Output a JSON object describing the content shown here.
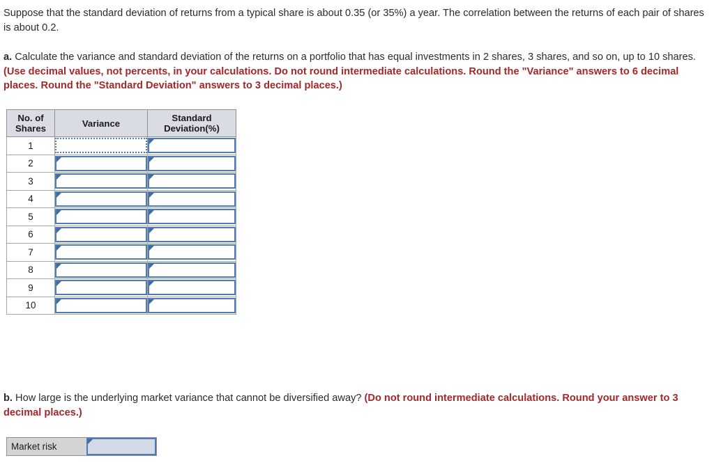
{
  "problem": {
    "intro": "Suppose that the standard deviation of returns from a typical share is about 0.35 (or 35%) a year. The correlation between the returns of each pair of shares is about 0.2.",
    "part_a": {
      "marker": "a.",
      "text": " Calculate the variance and standard deviation of the returns on a portfolio that has equal investments in 2 shares, 3 shares, and so on, up to 10 shares. ",
      "instruction": "(Use decimal values, not percents, in your calculations. Do not round intermediate calculations. Round the \"Variance\" answers to 6 decimal places. Round the \"Standard Deviation\" answers to 3 decimal places.)"
    },
    "part_b": {
      "marker": "b.",
      "text": " How large is the underlying market variance that cannot be diversified away? ",
      "instruction": "(Do not round intermediate calculations. Round your answer to 3 decimal places.)"
    }
  },
  "table": {
    "headers": [
      "No. of Shares",
      "Variance",
      "Standard Deviation(%)"
    ],
    "header_shares_line1": "No. of",
    "header_shares_line2": "Shares",
    "header_variance": "Variance",
    "header_sd_line1": "Standard",
    "header_sd_line2": "Deviation(%)",
    "rows": [
      {
        "shares": "1",
        "variance": "",
        "std_dev": ""
      },
      {
        "shares": "2",
        "variance": "",
        "std_dev": ""
      },
      {
        "shares": "3",
        "variance": "",
        "std_dev": ""
      },
      {
        "shares": "4",
        "variance": "",
        "std_dev": ""
      },
      {
        "shares": "5",
        "variance": "",
        "std_dev": ""
      },
      {
        "shares": "6",
        "variance": "",
        "std_dev": ""
      },
      {
        "shares": "7",
        "variance": "",
        "std_dev": ""
      },
      {
        "shares": "8",
        "variance": "",
        "std_dev": ""
      },
      {
        "shares": "9",
        "variance": "",
        "std_dev": ""
      },
      {
        "shares": "10",
        "variance": "",
        "std_dev": ""
      }
    ]
  },
  "market_risk": {
    "label": "Market risk",
    "value": "",
    "placeholder": ""
  },
  "colors": {
    "emphasis_red": "#a3282a",
    "header_fill": "#d9dce5",
    "input_border_blue": "#4f7cb4",
    "input_marker_blue": "#43699e",
    "label_fill_gray": "#d4d4d4",
    "market_input_fill": "#d5dae8",
    "body_text": "#2b2b2b"
  }
}
